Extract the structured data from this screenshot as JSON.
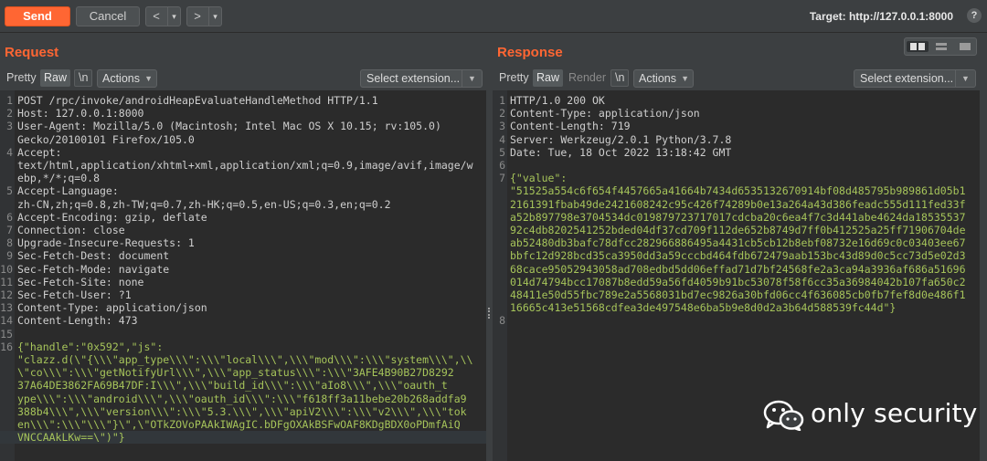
{
  "toolbar": {
    "send_label": "Send",
    "cancel_label": "Cancel",
    "back_label": "<",
    "forward_label": ">",
    "dropdown_glyph": "▾",
    "target_label": "Target: http://127.0.0.1:8000",
    "help_glyph": "?"
  },
  "request": {
    "title": "Request",
    "tabs": [
      "Pretty",
      "Raw",
      "\\n"
    ],
    "active_tab": "Raw",
    "actions_label": "Actions",
    "select_extension_label": "Select extension...",
    "lines": [
      {
        "n": "1",
        "text": "POST /rpc/invoke/androidHeapEvaluateHandleMethod HTTP/1.1"
      },
      {
        "n": "2",
        "text": "Host: 127.0.0.1:8000"
      },
      {
        "n": "3",
        "text": "User-Agent: Mozilla/5.0 (Macintosh; Intel Mac OS X 10.15; rv:105.0)"
      },
      {
        "n": "",
        "text": "Gecko/20100101 Firefox/105.0"
      },
      {
        "n": "4",
        "text": "Accept:"
      },
      {
        "n": "",
        "text": "text/html,application/xhtml+xml,application/xml;q=0.9,image/avif,image/w"
      },
      {
        "n": "",
        "text": "ebp,*/*;q=0.8"
      },
      {
        "n": "5",
        "text": "Accept-Language:"
      },
      {
        "n": "",
        "text": "zh-CN,zh;q=0.8,zh-TW;q=0.7,zh-HK;q=0.5,en-US;q=0.3,en;q=0.2"
      },
      {
        "n": "6",
        "text": "Accept-Encoding: gzip, deflate"
      },
      {
        "n": "7",
        "text": "Connection: close"
      },
      {
        "n": "8",
        "text": "Upgrade-Insecure-Requests: 1"
      },
      {
        "n": "9",
        "text": "Sec-Fetch-Dest: document"
      },
      {
        "n": "10",
        "text": "Sec-Fetch-Mode: navigate"
      },
      {
        "n": "11",
        "text": "Sec-Fetch-Site: none"
      },
      {
        "n": "12",
        "text": "Sec-Fetch-User: ?1"
      },
      {
        "n": "13",
        "text": "Content-Type: application/json"
      },
      {
        "n": "14",
        "text": "Content-Length: 473"
      },
      {
        "n": "15",
        "text": ""
      },
      {
        "n": "16",
        "text": "{\"handle\":\"0x592\",\"js\":"
      },
      {
        "n": "",
        "text": "\"clazz.d(\\\"{\\\\\\\"app_type\\\\\\\":\\\\\\\"local\\\\\\\",\\\\\\\"mod\\\\\\\":\\\\\\\"system\\\\\\\",\\\\"
      },
      {
        "n": "",
        "text": "\\\"co\\\\\\\":\\\\\\\"getNotifyUrl\\\\\\\",\\\\\\\"app_status\\\\\\\":\\\\\\\"3AFE4B90B27D8292"
      },
      {
        "n": "",
        "text": "37A64DE3862FA69B47DF:I\\\\\\\",\\\\\\\"build_id\\\\\\\":\\\\\\\"aIo8\\\\\\\",\\\\\\\"oauth_t"
      },
      {
        "n": "",
        "text": "ype\\\\\\\":\\\\\\\"android\\\\\\\",\\\\\\\"oauth_id\\\\\\\":\\\\\\\"f618ff3a11bebe20b268addfa9"
      },
      {
        "n": "",
        "text": "388b4\\\\\\\",\\\\\\\"version\\\\\\\":\\\\\\\"5.3.\\\\\\\",\\\\\\\"apiV2\\\\\\\":\\\\\\\"v2\\\\\\\",\\\\\\\"tok"
      },
      {
        "n": "",
        "text": "en\\\\\\\":\\\\\\\"\\\\\\\"}\\\",\\\"OTkZOVoPAAkIWAgIC.bDFgOXAkBSFwOAF8KDgBDX0oPDmfAiQ"
      },
      {
        "n": "",
        "text": "VNCCAAkLKw==\\\")\"}"
      }
    ]
  },
  "response": {
    "title": "Response",
    "tabs": [
      "Pretty",
      "Raw",
      "Render",
      "\\n"
    ],
    "active_tab": "Raw",
    "actions_label": "Actions",
    "select_extension_label": "Select extension...",
    "lines": [
      {
        "n": "1",
        "text": "HTTP/1.0 200 OK"
      },
      {
        "n": "2",
        "text": "Content-Type: application/json"
      },
      {
        "n": "3",
        "text": "Content-Length: 719"
      },
      {
        "n": "4",
        "text": "Server: Werkzeug/2.0.1 Python/3.7.8"
      },
      {
        "n": "5",
        "text": "Date: Tue, 18 Oct 2022 13:18:42 GMT"
      },
      {
        "n": "6",
        "text": ""
      },
      {
        "n": "7",
        "text": "{\"value\":"
      },
      {
        "n": "",
        "text": "\"51525a554c6f654f4457665a41664b7434d6535132670914bf08d485795b989861d05b1"
      },
      {
        "n": "",
        "text": "2161391fbab49de2421608242c95c426f74289b0e13a264a43d386feadc555d111fed33f"
      },
      {
        "n": "",
        "text": "a52b897798e3704534dc019879723717017cdcba20c6ea4f7c3d441abe4624da18535537"
      },
      {
        "n": "",
        "text": "92c4db8202541252bded04df37cd709f112de652b8749d7ff0b412525a25ff71906704de"
      },
      {
        "n": "",
        "text": "ab52480db3bafc78dfcc282966886495a4431cb5cb12b8ebf08732e16d69c0c03403ee67"
      },
      {
        "n": "",
        "text": "bbfc12d928bcd35ca3950dd3a59cccbd464fdb672479aab153bc43d89d0c5cc73d5e02d3"
      },
      {
        "n": "",
        "text": "68cace95052943058ad708edbd5dd06effad71d7bf24568fe2a3ca94a3936af686a51696"
      },
      {
        "n": "",
        "text": "014d74794bcc17087b8edd59a56fd4059b91bc53078f58f6cc35a36984042b107fa650c2"
      },
      {
        "n": "",
        "text": "48411e50d55fbc789e2a5568031bd7ec9826a30bfd06cc4f636085cb0fb7fef8d0e486f1"
      },
      {
        "n": "",
        "text": "16665c413e51568cdfea3de497548e6ba5b9e8d0d2a3b64d588539fc44d\"}"
      },
      {
        "n": "8",
        "text": ""
      }
    ]
  },
  "watermark": {
    "text": "only security",
    "icon": "wechat-icon"
  },
  "colors": {
    "accent": "#ff6633",
    "background": "#3c3f41",
    "editor": "#2b2b2b",
    "json_green": "#a6c45a"
  }
}
